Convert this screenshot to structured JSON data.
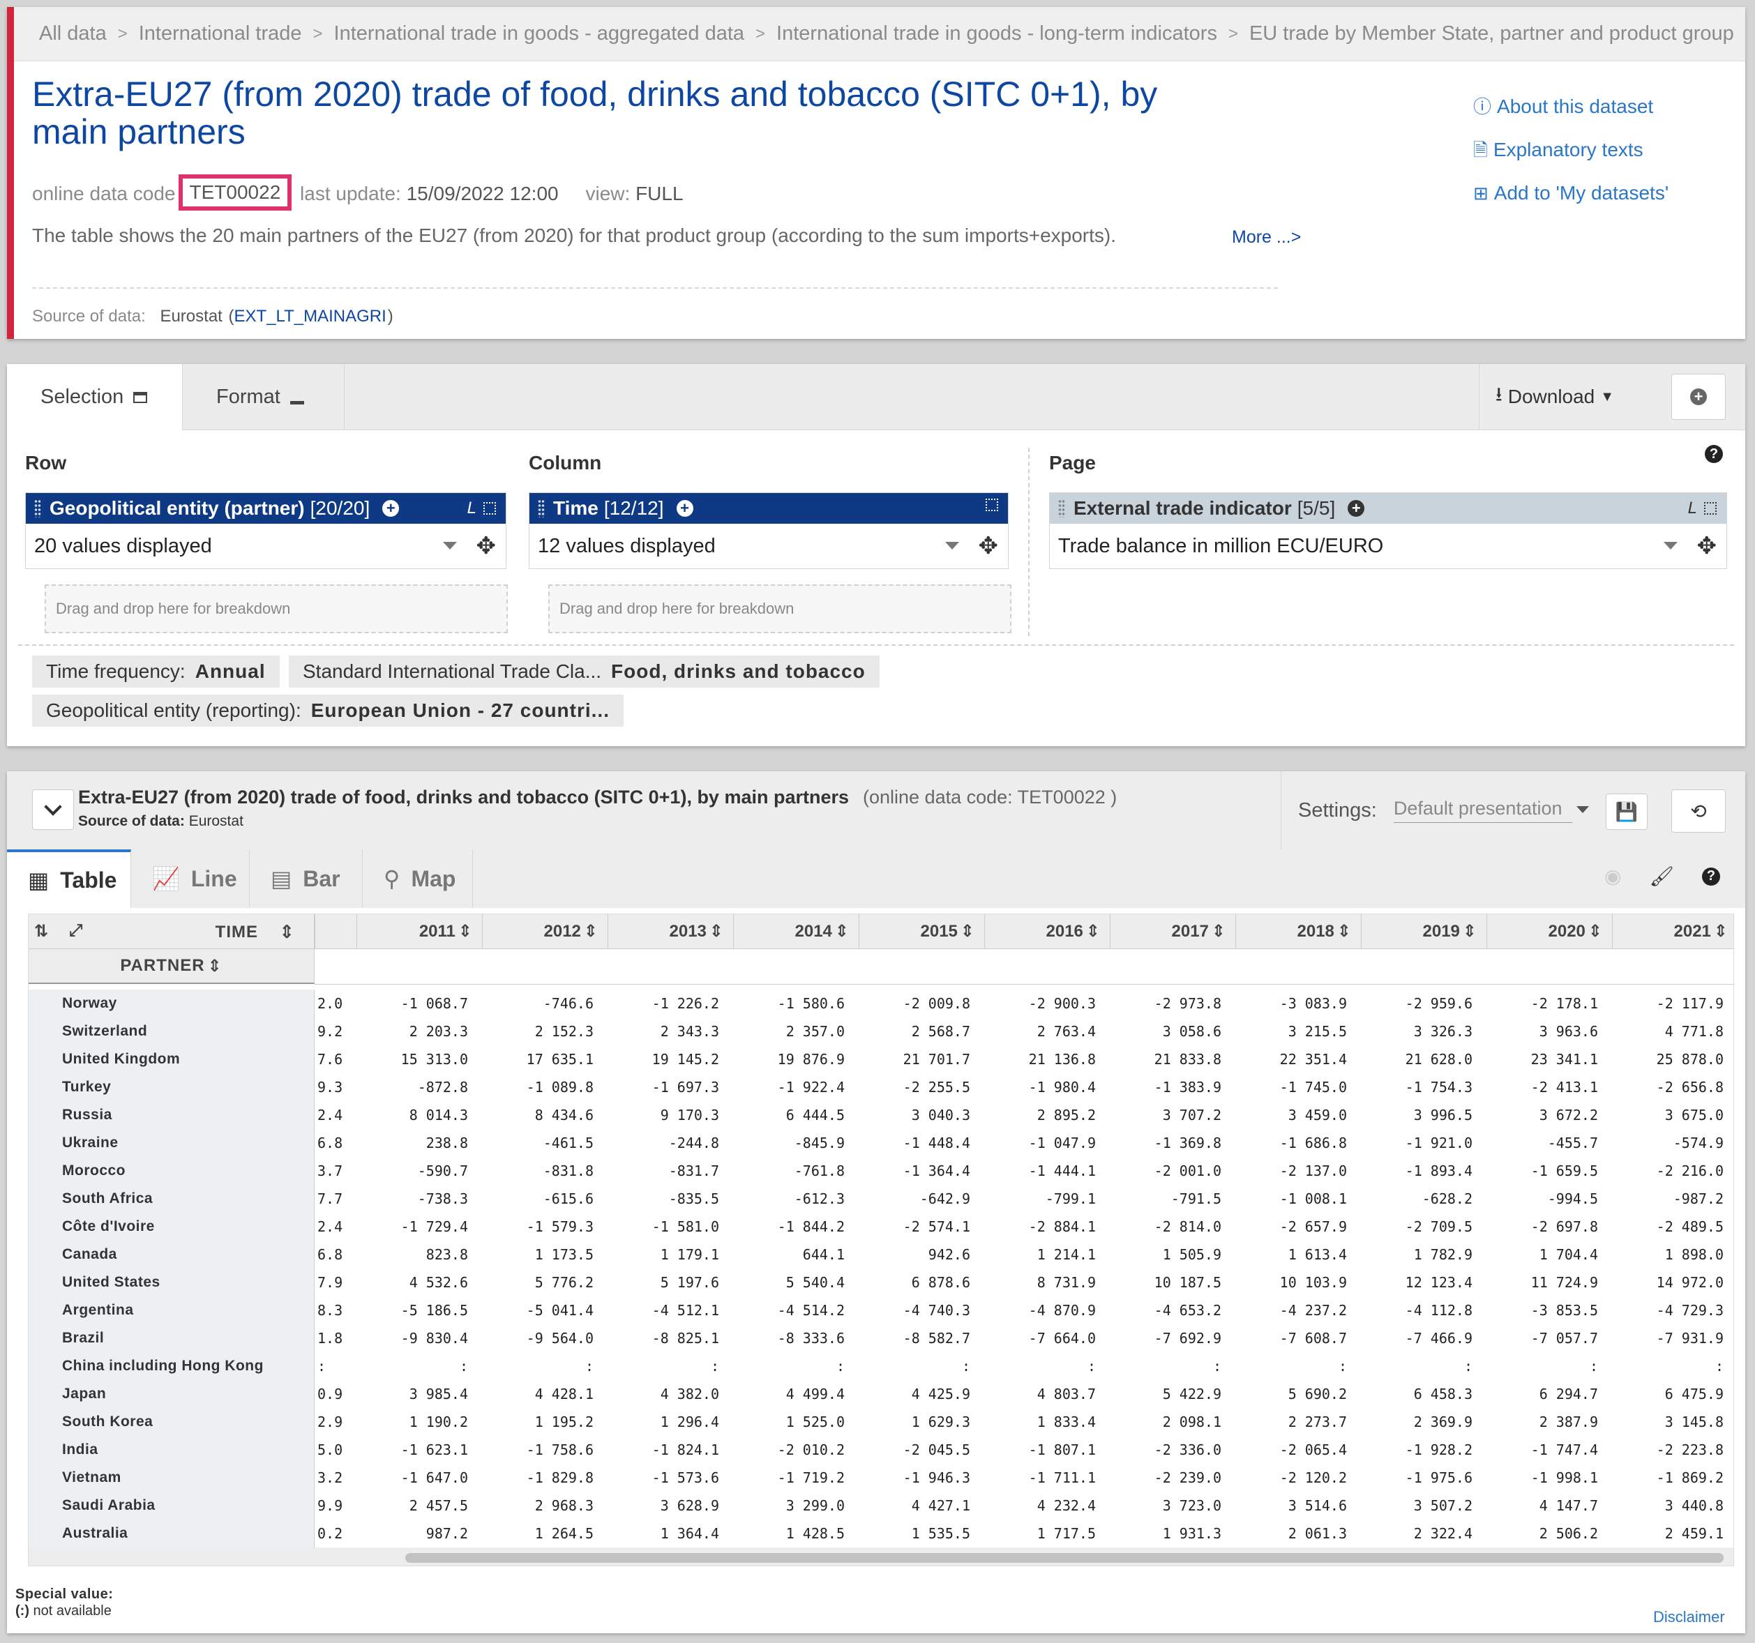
{
  "breadcrumb": [
    "All data",
    "International trade",
    "International trade in goods - aggregated data",
    "International trade in goods - long-term indicators",
    "EU trade by Member State, partner and product group"
  ],
  "header": {
    "title": "Extra-EU27 (from 2020) trade of food, drinks and tobacco (SITC 0+1), by main partners",
    "code_label": "online data code",
    "code": "TET00022",
    "update_label": "last update:",
    "update": "15/09/2022 12:00",
    "view_label": "view:",
    "view": "FULL",
    "description": "The table shows the 20 main partners of the EU27 (from 2020) for that product group (according to the sum imports+exports).",
    "more": "More ...>",
    "source_label": "Source of data:",
    "source_org": "Eurostat",
    "source_code": "EXT_LT_MAINAGRI",
    "links": {
      "about": "About this dataset",
      "explanatory": "Explanatory texts",
      "add": "Add to 'My datasets'"
    }
  },
  "selection": {
    "tab_selection": "Selection",
    "tab_format": "Format",
    "download": "Download",
    "row_label": "Row",
    "column_label": "Column",
    "page_label": "Page",
    "row_dim": {
      "name": "Geopolitical entity (partner)",
      "count": "[20/20]",
      "value": "20 values displayed"
    },
    "col_dim": {
      "name": "Time",
      "count": "[12/12]",
      "value": "12 values displayed"
    },
    "page_dim": {
      "name": "External trade indicator",
      "count": "[5/5]",
      "value": "Trade balance in million ECU/EURO"
    },
    "dropzone": "Drag and drop here for breakdown",
    "filters": [
      {
        "label": "Time frequency:",
        "value": "Annual"
      },
      {
        "label": "Standard International Trade Cla...",
        "value": "Food, drinks and tobacco"
      },
      {
        "label": "Geopolitical entity (reporting):",
        "value": "European Union - 27 countri..."
      }
    ]
  },
  "table_panel": {
    "title": "Extra-EU27 (from 2020) trade of food, drinks and tobacco (SITC 0+1), by main partners",
    "code": "(online data code: TET00022 )",
    "source_label": "Source of data:",
    "source": "Eurostat",
    "settings_label": "Settings:",
    "settings_value": "Default presentation",
    "tabs": [
      "Table",
      "Line",
      "Bar",
      "Map"
    ],
    "time_header": "TIME",
    "partner_header": "PARTNER",
    "years": [
      "2011",
      "2012",
      "2013",
      "2014",
      "2015",
      "2016",
      "2017",
      "2018",
      "2019",
      "2020",
      "2021"
    ],
    "rows": [
      {
        "partner": "Norway",
        "first": "2.0",
        "values": [
          "-1 068.7",
          "-746.6",
          "-1 226.2",
          "-1 580.6",
          "-2 009.8",
          "-2 900.3",
          "-2 973.8",
          "-3 083.9",
          "-2 959.6",
          "-2 178.1",
          "-2 117.9"
        ]
      },
      {
        "partner": "Switzerland",
        "first": "9.2",
        "values": [
          "2 203.3",
          "2 152.3",
          "2 343.3",
          "2 357.0",
          "2 568.7",
          "2 763.4",
          "3 058.6",
          "3 215.5",
          "3 326.3",
          "3 963.6",
          "4 771.8"
        ]
      },
      {
        "partner": "United Kingdom",
        "first": "7.6",
        "values": [
          "15 313.0",
          "17 635.1",
          "19 145.2",
          "19 876.9",
          "21 701.7",
          "21 136.8",
          "21 833.8",
          "22 351.4",
          "21 628.0",
          "23 341.1",
          "25 878.0"
        ]
      },
      {
        "partner": "Turkey",
        "first": "9.3",
        "values": [
          "-872.8",
          "-1 089.8",
          "-1 697.3",
          "-1 922.4",
          "-2 255.5",
          "-1 980.4",
          "-1 383.9",
          "-1 745.0",
          "-1 754.3",
          "-2 413.1",
          "-2 656.8"
        ]
      },
      {
        "partner": "Russia",
        "first": "2.4",
        "values": [
          "8 014.3",
          "8 434.6",
          "9 170.3",
          "6 444.5",
          "3 040.3",
          "2 895.2",
          "3 707.2",
          "3 459.0",
          "3 996.5",
          "3 672.2",
          "3 675.0"
        ]
      },
      {
        "partner": "Ukraine",
        "first": "6.8",
        "values": [
          "238.8",
          "-461.5",
          "-244.8",
          "-845.9",
          "-1 448.4",
          "-1 047.9",
          "-1 369.8",
          "-1 686.8",
          "-1 921.0",
          "-455.7",
          "-574.9"
        ]
      },
      {
        "partner": "Morocco",
        "first": "3.7",
        "values": [
          "-590.7",
          "-831.8",
          "-831.7",
          "-761.8",
          "-1 364.4",
          "-1 444.1",
          "-2 001.0",
          "-2 137.0",
          "-1 893.4",
          "-1 659.5",
          "-2 216.0"
        ]
      },
      {
        "partner": "South Africa",
        "first": "7.7",
        "values": [
          "-738.3",
          "-615.6",
          "-835.5",
          "-612.3",
          "-642.9",
          "-799.1",
          "-791.5",
          "-1 008.1",
          "-628.2",
          "-994.5",
          "-987.2"
        ]
      },
      {
        "partner": "Côte d'Ivoire",
        "first": "2.4",
        "values": [
          "-1 729.4",
          "-1 579.3",
          "-1 581.0",
          "-1 844.2",
          "-2 574.1",
          "-2 884.1",
          "-2 814.0",
          "-2 657.9",
          "-2 709.5",
          "-2 697.8",
          "-2 489.5"
        ]
      },
      {
        "partner": "Canada",
        "first": "6.8",
        "values": [
          "823.8",
          "1 173.5",
          "1 179.1",
          "644.1",
          "942.6",
          "1 214.1",
          "1 505.9",
          "1 613.4",
          "1 782.9",
          "1 704.4",
          "1 898.0"
        ]
      },
      {
        "partner": "United States",
        "first": "7.9",
        "values": [
          "4 532.6",
          "5 776.2",
          "5 197.6",
          "5 540.4",
          "6 878.6",
          "8 731.9",
          "10 187.5",
          "10 103.9",
          "12 123.4",
          "11 724.9",
          "14 972.0"
        ]
      },
      {
        "partner": "Argentina",
        "first": "8.3",
        "values": [
          "-5 186.5",
          "-5 041.4",
          "-4 512.1",
          "-4 514.2",
          "-4 740.3",
          "-4 870.9",
          "-4 653.2",
          "-4 237.2",
          "-4 112.8",
          "-3 853.5",
          "-4 729.3"
        ]
      },
      {
        "partner": "Brazil",
        "first": "1.8",
        "values": [
          "-9 830.4",
          "-9 564.0",
          "-8 825.1",
          "-8 333.6",
          "-8 582.7",
          "-7 664.0",
          "-7 692.9",
          "-7 608.7",
          "-7 466.9",
          "-7 057.7",
          "-7 931.9"
        ]
      },
      {
        "partner": "China including Hong Kong",
        "first": ":",
        "values": [
          ":",
          ":",
          ":",
          ":",
          ":",
          ":",
          ":",
          ":",
          ":",
          ":",
          ":"
        ]
      },
      {
        "partner": "Japan",
        "first": "0.9",
        "values": [
          "3 985.4",
          "4 428.1",
          "4 382.0",
          "4 499.4",
          "4 425.9",
          "4 803.7",
          "5 422.9",
          "5 690.2",
          "6 458.3",
          "6 294.7",
          "6 475.9"
        ]
      },
      {
        "partner": "South Korea",
        "first": "2.9",
        "values": [
          "1 190.2",
          "1 195.2",
          "1 296.4",
          "1 525.0",
          "1 629.3",
          "1 833.4",
          "2 098.1",
          "2 273.7",
          "2 369.9",
          "2 387.9",
          "3 145.8"
        ]
      },
      {
        "partner": "India",
        "first": "5.0",
        "values": [
          "-1 623.1",
          "-1 758.6",
          "-1 824.1",
          "-2 010.2",
          "-2 045.5",
          "-1 807.1",
          "-2 336.0",
          "-2 065.4",
          "-1 928.2",
          "-1 747.4",
          "-2 223.8"
        ]
      },
      {
        "partner": "Vietnam",
        "first": "3.2",
        "values": [
          "-1 647.0",
          "-1 829.8",
          "-1 573.6",
          "-1 719.2",
          "-1 946.3",
          "-1 711.1",
          "-2 239.0",
          "-2 120.2",
          "-1 975.6",
          "-1 998.1",
          "-1 869.2"
        ]
      },
      {
        "partner": "Saudi Arabia",
        "first": "9.9",
        "values": [
          "2 457.5",
          "2 968.3",
          "3 628.9",
          "3 299.0",
          "4 427.1",
          "4 232.4",
          "3 723.0",
          "3 514.6",
          "3 507.2",
          "4 147.7",
          "3 440.8"
        ]
      },
      {
        "partner": "Australia",
        "first": "0.2",
        "values": [
          "987.2",
          "1 264.5",
          "1 364.4",
          "1 428.5",
          "1 535.5",
          "1 717.5",
          "1 931.3",
          "2 061.3",
          "2 322.4",
          "2 506.2",
          "2 459.1"
        ]
      }
    ],
    "special_title": "Special value:",
    "special_sym": "(:)",
    "special_text": "not available",
    "disclaimer": "Disclaimer"
  },
  "colors": {
    "brand_blue": "#0e47a1",
    "dim_header": "#0e3a85",
    "accent_red": "#d0253c",
    "highlight": "#e0306e"
  }
}
